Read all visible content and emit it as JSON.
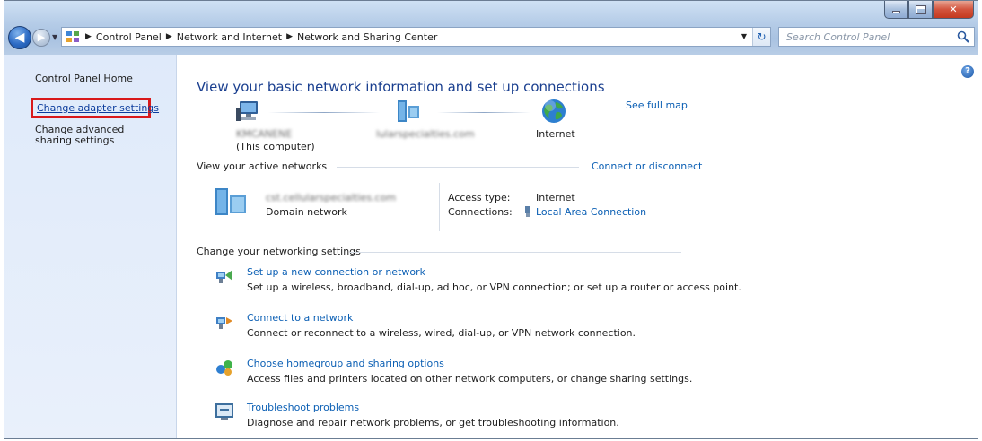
{
  "window": {
    "address_crumbs": [
      "Control Panel",
      "Network and Internet",
      "Network and Sharing Center"
    ],
    "search_placeholder": "Search Control Panel"
  },
  "left_pane": {
    "home_label": "Control Panel Home",
    "links": [
      "Change adapter settings",
      "Change advanced sharing settings"
    ]
  },
  "main": {
    "title": "View your basic network information and set up connections",
    "see_full_map": "See full map",
    "map": {
      "computer_name": "KMCANENE",
      "computer_caption": "(This computer)",
      "domain_name": "lularspecialties.com",
      "internet_label": "Internet"
    },
    "active_networks": {
      "heading": "View your active networks",
      "connect_link": "Connect or disconnect",
      "network_name": "cst.cellularspecialties.com",
      "network_type": "Domain network",
      "access_type_label": "Access type:",
      "access_type_value": "Internet",
      "connections_label": "Connections:",
      "connections_value": "Local Area Connection"
    },
    "settings": {
      "heading": "Change your networking settings",
      "tasks": [
        {
          "link": "Set up a new connection or network",
          "desc": "Set up a wireless, broadband, dial-up, ad hoc, or VPN connection; or set up a router or access point."
        },
        {
          "link": "Connect to a network",
          "desc": "Connect or reconnect to a wireless, wired, dial-up, or VPN network connection."
        },
        {
          "link": "Choose homegroup and sharing options",
          "desc": "Access files and printers located on other network computers, or change sharing settings."
        },
        {
          "link": "Troubleshoot problems",
          "desc": "Diagnose and repair network problems, or get troubleshooting information."
        }
      ]
    }
  },
  "colors": {
    "link": "#0b5fb4",
    "title": "#1a3f8f",
    "highlight_box": "#d8191b",
    "left_pane_bg": "#dfeafa"
  },
  "icons": [
    "back-arrow-icon",
    "forward-arrow-icon",
    "control-panel-icon",
    "refresh-icon",
    "search-icon",
    "minimize-icon",
    "maximize-icon",
    "close-icon",
    "help-icon",
    "computer-icon",
    "network-icon",
    "globe-icon",
    "domain-network-icon",
    "ethernet-icon",
    "new-connection-icon",
    "connect-network-icon",
    "homegroup-icon",
    "troubleshoot-icon"
  ]
}
